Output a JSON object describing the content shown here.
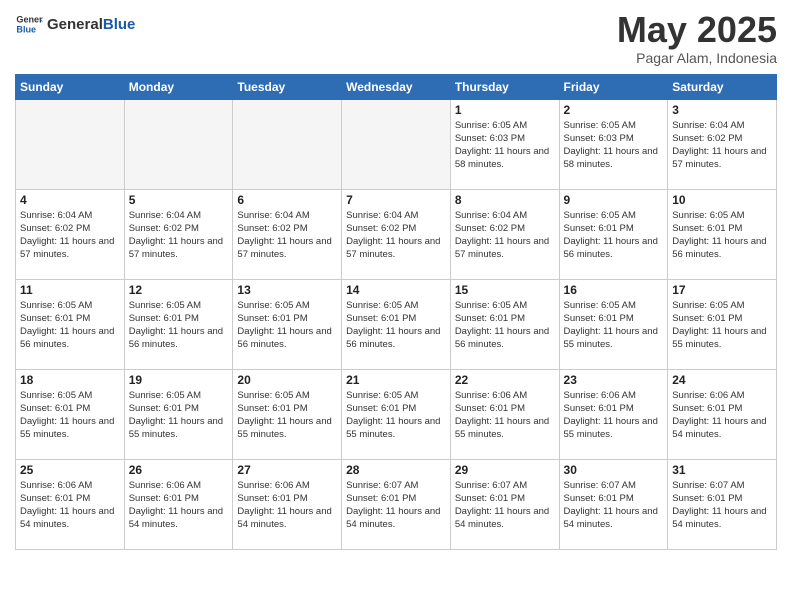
{
  "header": {
    "logo_general": "General",
    "logo_blue": "Blue",
    "month_year": "May 2025",
    "location": "Pagar Alam, Indonesia"
  },
  "weekdays": [
    "Sunday",
    "Monday",
    "Tuesday",
    "Wednesday",
    "Thursday",
    "Friday",
    "Saturday"
  ],
  "weeks": [
    [
      {
        "day": "",
        "empty": true
      },
      {
        "day": "",
        "empty": true
      },
      {
        "day": "",
        "empty": true
      },
      {
        "day": "",
        "empty": true
      },
      {
        "day": "1",
        "sunrise": "6:05 AM",
        "sunset": "6:03 PM",
        "daylight": "11 hours and 58 minutes."
      },
      {
        "day": "2",
        "sunrise": "6:05 AM",
        "sunset": "6:03 PM",
        "daylight": "11 hours and 58 minutes."
      },
      {
        "day": "3",
        "sunrise": "6:04 AM",
        "sunset": "6:02 PM",
        "daylight": "11 hours and 57 minutes."
      }
    ],
    [
      {
        "day": "4",
        "sunrise": "6:04 AM",
        "sunset": "6:02 PM",
        "daylight": "11 hours and 57 minutes."
      },
      {
        "day": "5",
        "sunrise": "6:04 AM",
        "sunset": "6:02 PM",
        "daylight": "11 hours and 57 minutes."
      },
      {
        "day": "6",
        "sunrise": "6:04 AM",
        "sunset": "6:02 PM",
        "daylight": "11 hours and 57 minutes."
      },
      {
        "day": "7",
        "sunrise": "6:04 AM",
        "sunset": "6:02 PM",
        "daylight": "11 hours and 57 minutes."
      },
      {
        "day": "8",
        "sunrise": "6:04 AM",
        "sunset": "6:02 PM",
        "daylight": "11 hours and 57 minutes."
      },
      {
        "day": "9",
        "sunrise": "6:05 AM",
        "sunset": "6:01 PM",
        "daylight": "11 hours and 56 minutes."
      },
      {
        "day": "10",
        "sunrise": "6:05 AM",
        "sunset": "6:01 PM",
        "daylight": "11 hours and 56 minutes."
      }
    ],
    [
      {
        "day": "11",
        "sunrise": "6:05 AM",
        "sunset": "6:01 PM",
        "daylight": "11 hours and 56 minutes."
      },
      {
        "day": "12",
        "sunrise": "6:05 AM",
        "sunset": "6:01 PM",
        "daylight": "11 hours and 56 minutes."
      },
      {
        "day": "13",
        "sunrise": "6:05 AM",
        "sunset": "6:01 PM",
        "daylight": "11 hours and 56 minutes."
      },
      {
        "day": "14",
        "sunrise": "6:05 AM",
        "sunset": "6:01 PM",
        "daylight": "11 hours and 56 minutes."
      },
      {
        "day": "15",
        "sunrise": "6:05 AM",
        "sunset": "6:01 PM",
        "daylight": "11 hours and 56 minutes."
      },
      {
        "day": "16",
        "sunrise": "6:05 AM",
        "sunset": "6:01 PM",
        "daylight": "11 hours and 55 minutes."
      },
      {
        "day": "17",
        "sunrise": "6:05 AM",
        "sunset": "6:01 PM",
        "daylight": "11 hours and 55 minutes."
      }
    ],
    [
      {
        "day": "18",
        "sunrise": "6:05 AM",
        "sunset": "6:01 PM",
        "daylight": "11 hours and 55 minutes."
      },
      {
        "day": "19",
        "sunrise": "6:05 AM",
        "sunset": "6:01 PM",
        "daylight": "11 hours and 55 minutes."
      },
      {
        "day": "20",
        "sunrise": "6:05 AM",
        "sunset": "6:01 PM",
        "daylight": "11 hours and 55 minutes."
      },
      {
        "day": "21",
        "sunrise": "6:05 AM",
        "sunset": "6:01 PM",
        "daylight": "11 hours and 55 minutes."
      },
      {
        "day": "22",
        "sunrise": "6:06 AM",
        "sunset": "6:01 PM",
        "daylight": "11 hours and 55 minutes."
      },
      {
        "day": "23",
        "sunrise": "6:06 AM",
        "sunset": "6:01 PM",
        "daylight": "11 hours and 55 minutes."
      },
      {
        "day": "24",
        "sunrise": "6:06 AM",
        "sunset": "6:01 PM",
        "daylight": "11 hours and 54 minutes."
      }
    ],
    [
      {
        "day": "25",
        "sunrise": "6:06 AM",
        "sunset": "6:01 PM",
        "daylight": "11 hours and 54 minutes."
      },
      {
        "day": "26",
        "sunrise": "6:06 AM",
        "sunset": "6:01 PM",
        "daylight": "11 hours and 54 minutes."
      },
      {
        "day": "27",
        "sunrise": "6:06 AM",
        "sunset": "6:01 PM",
        "daylight": "11 hours and 54 minutes."
      },
      {
        "day": "28",
        "sunrise": "6:07 AM",
        "sunset": "6:01 PM",
        "daylight": "11 hours and 54 minutes."
      },
      {
        "day": "29",
        "sunrise": "6:07 AM",
        "sunset": "6:01 PM",
        "daylight": "11 hours and 54 minutes."
      },
      {
        "day": "30",
        "sunrise": "6:07 AM",
        "sunset": "6:01 PM",
        "daylight": "11 hours and 54 minutes."
      },
      {
        "day": "31",
        "sunrise": "6:07 AM",
        "sunset": "6:01 PM",
        "daylight": "11 hours and 54 minutes."
      }
    ]
  ]
}
